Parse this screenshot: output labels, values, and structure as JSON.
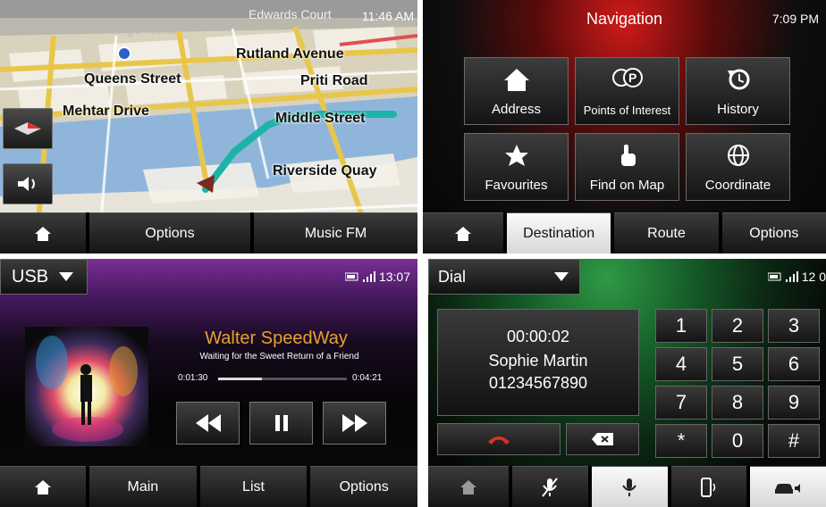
{
  "map": {
    "clock": "11:46 AM",
    "streets": [
      "Edwards Court",
      "George Road",
      "Rutland Avenue",
      "Queens Street",
      "Priti Road",
      "Mehtar Drive",
      "Middle Street",
      "Riverside Quay"
    ],
    "bar": {
      "options_label": "Options",
      "music_label": "Music FM"
    }
  },
  "nav": {
    "title": "Navigation",
    "clock": "7:09 PM",
    "tiles": [
      {
        "label": "Address",
        "icon": "house-icon"
      },
      {
        "label": "Points of Interest",
        "icon": "poi-icon"
      },
      {
        "label": "History",
        "icon": "history-icon"
      },
      {
        "label": "Favourites",
        "icon": "star-icon"
      },
      {
        "label": "Find on Map",
        "icon": "hand-pointer-icon"
      },
      {
        "label": "Coordinate",
        "icon": "globe-icon"
      }
    ],
    "bar": {
      "destination_label": "Destination",
      "route_label": "Route",
      "options_label": "Options"
    }
  },
  "music": {
    "source": "USB",
    "clock": "13:07",
    "song_title": "Walter SpeedWay",
    "song_subtitle": "Waiting for the Sweet Return of a Friend",
    "elapsed": "0:01:30",
    "duration": "0:04:21",
    "progress_fraction": 0.34,
    "accent": "#e8a030",
    "bar": {
      "main_label": "Main",
      "list_label": "List",
      "options_label": "Options"
    }
  },
  "dial": {
    "mode": "Dial",
    "clock": "12 0",
    "call_time": "00:00:02",
    "contact_name": "Sophie Martin",
    "contact_number": "01234567890",
    "keys": [
      "1",
      "2",
      "3",
      "4",
      "5",
      "6",
      "7",
      "8",
      "9",
      "*",
      "0",
      "#"
    ],
    "end_call_color": "#e0321e"
  }
}
